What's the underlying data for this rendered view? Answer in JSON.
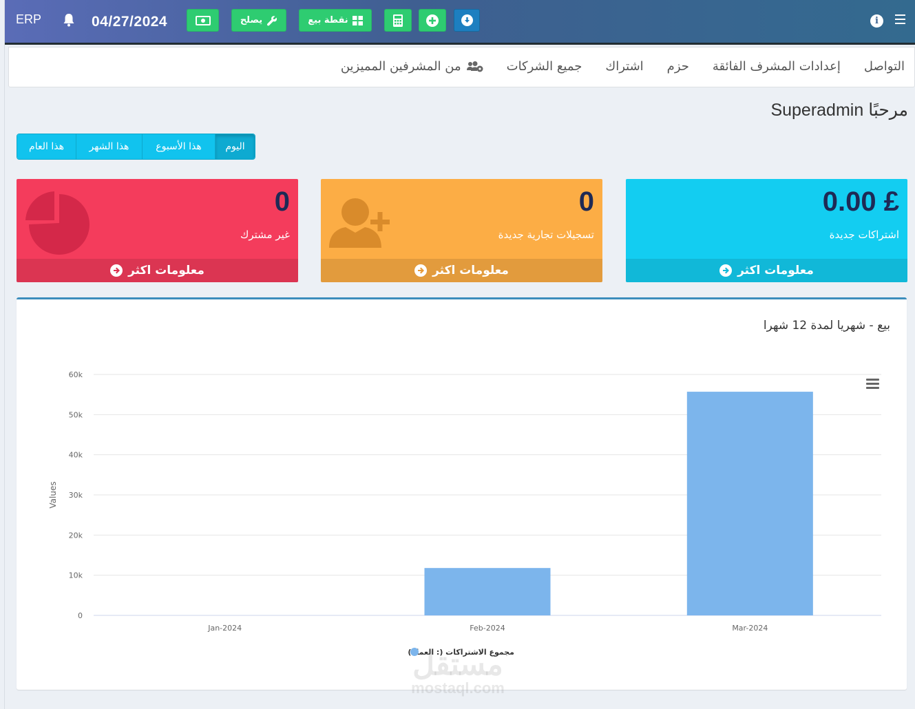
{
  "topbar": {
    "brand": "ERP",
    "date": "04/27/2024",
    "buttons": {
      "repair": "يصلح",
      "pos": "نقطة بيع"
    },
    "icons": [
      "bell-icon",
      "money-icon",
      "wrench-icon",
      "th-large-icon",
      "calculator-icon",
      "plus-circle-icon",
      "download-circle-icon",
      "info-icon",
      "menu-icon"
    ],
    "colors": {
      "green": "#2ecc71",
      "blue": "#1d7fc0"
    }
  },
  "nav": {
    "items": [
      "من المشرفين المميزين",
      "جميع الشركات",
      "اشتراك",
      "حزم",
      "إعدادات المشرف الفائقة",
      "التواصل"
    ]
  },
  "welcome": "مرحبًا Superadmin",
  "periods": {
    "today": "اليوم",
    "week": "هذا الأسبوع",
    "month": "هذا الشهر",
    "year": "هذا العام"
  },
  "boxes": {
    "subscriptions": {
      "value": "£ 0.00",
      "label": "اشتراكات جديدة",
      "more": "معلومات اكثر",
      "color": "#13cdf1"
    },
    "registrations": {
      "value": "0",
      "label": "تسجيلات تجارية جديدة",
      "more": "معلومات اكثر",
      "color": "#fcad45"
    },
    "nonsubscribers": {
      "value": "0",
      "label": "غير مشترك",
      "more": "معلومات اكثر",
      "color": "#f43c5c"
    }
  },
  "chart_card": {
    "title": "بيع - شهريا لمدة 12 شهرا"
  },
  "chart_data": {
    "type": "bar",
    "categories": [
      "Jan-2024",
      "Feb-2024",
      "Mar-2024"
    ],
    "series": [
      {
        "name": "مجموع الاشتراكات (: العملة)",
        "values": [
          0,
          11800,
          55700
        ],
        "color": "#7cb5ec"
      }
    ],
    "ylabel": "Values",
    "ylim": [
      0,
      60000
    ],
    "yticks": [
      "0",
      "10k",
      "20k",
      "30k",
      "40k",
      "50k",
      "60k"
    ],
    "grid": true,
    "legend": "bottom-center"
  },
  "watermark": {
    "ar": "مستقل",
    "en": "mostaql.com"
  }
}
